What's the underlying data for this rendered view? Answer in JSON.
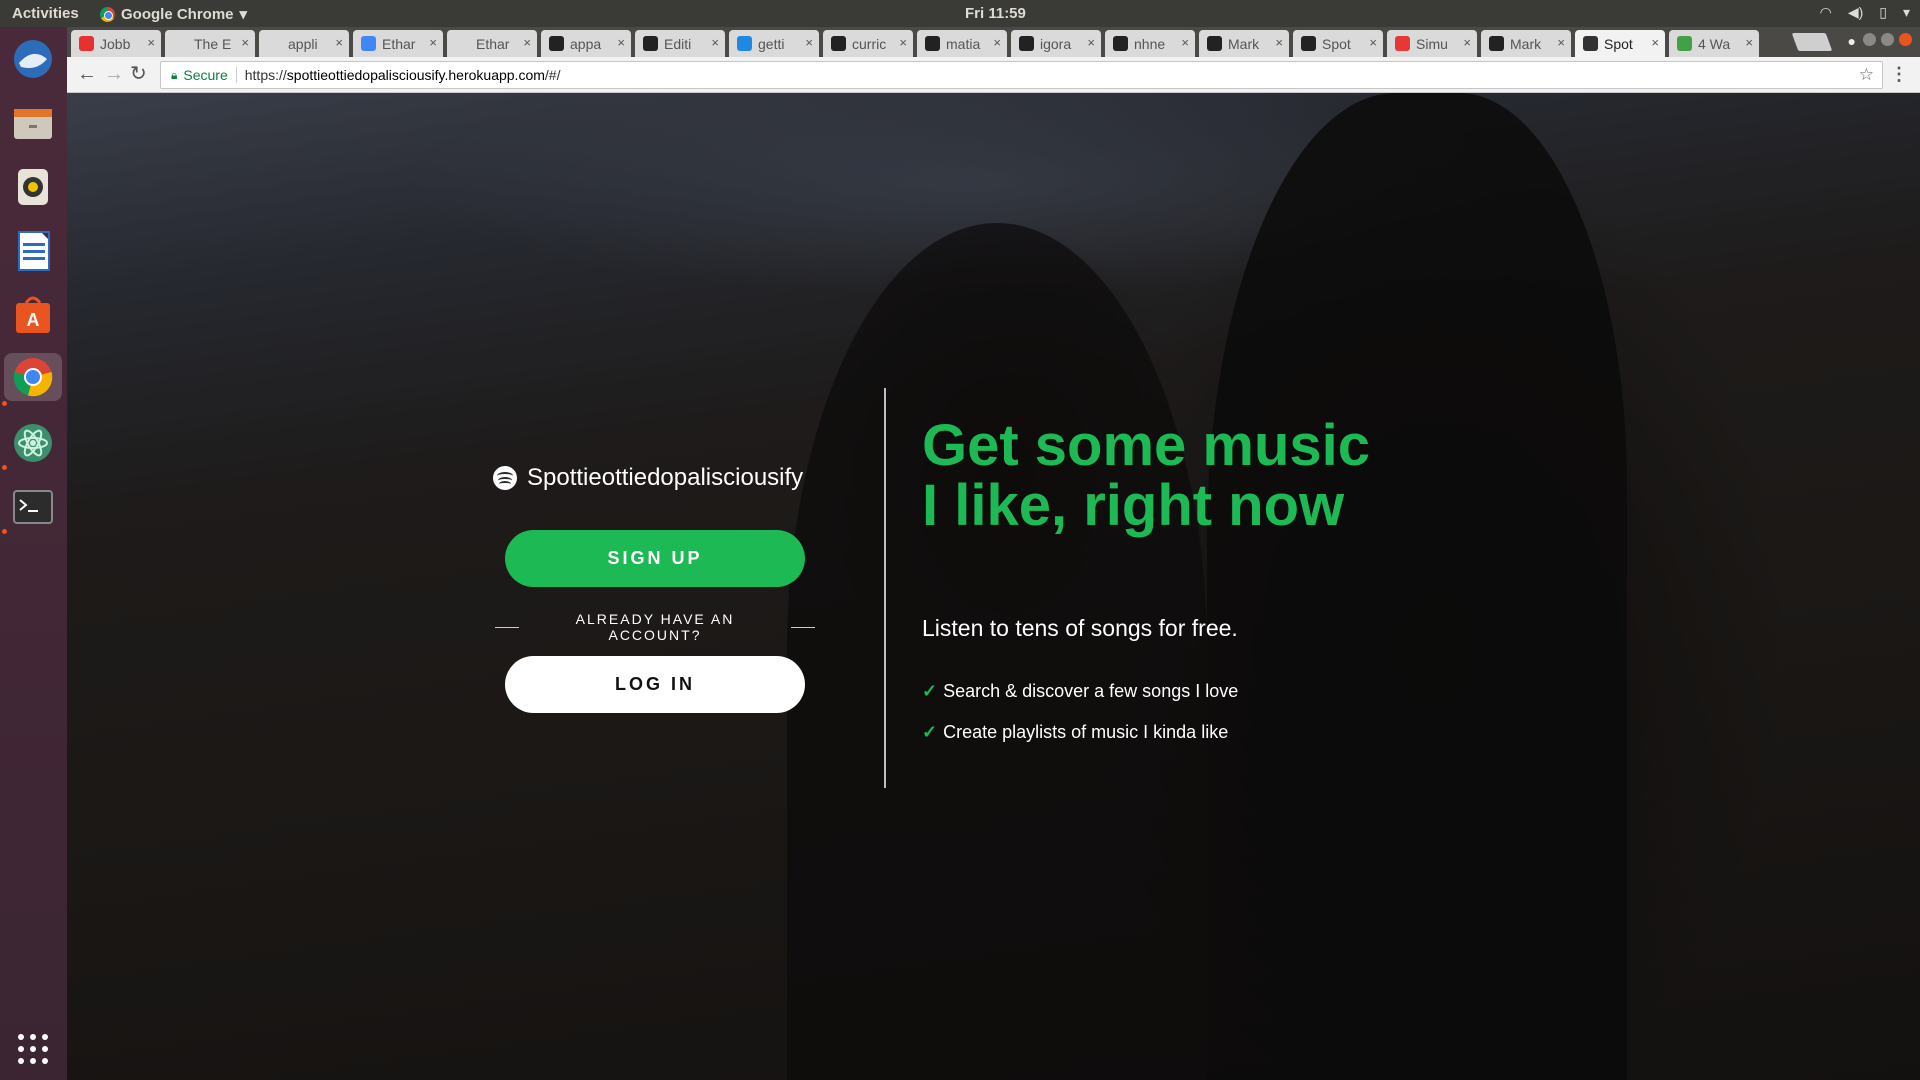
{
  "system_bar": {
    "activities": "Activities",
    "app_name": "Google Chrome",
    "clock": "Fri 11:59"
  },
  "launcher": {
    "apps": [
      "thunderbird-icon",
      "files-icon",
      "rhythmbox-icon",
      "writer-icon",
      "software-center-icon",
      "chrome-icon",
      "atom-icon",
      "terminal-icon",
      "show-apps-icon"
    ]
  },
  "browser": {
    "tabs": [
      {
        "label": "Jobb",
        "favicon_color": "#e8312f"
      },
      {
        "label": "The E",
        "favicon_color": "#dadada"
      },
      {
        "label": "appli",
        "favicon_color": "#dadada"
      },
      {
        "label": "Ethar",
        "favicon_color": "#4285f4"
      },
      {
        "label": "Ethar",
        "favicon_color": "#dadada"
      },
      {
        "label": "appa",
        "favicon_color": "#222222"
      },
      {
        "label": "Editi",
        "favicon_color": "#222222"
      },
      {
        "label": "getti",
        "favicon_color": "#1e88e5"
      },
      {
        "label": "curric",
        "favicon_color": "#222222"
      },
      {
        "label": "matia",
        "favicon_color": "#222222"
      },
      {
        "label": "igora",
        "favicon_color": "#222222"
      },
      {
        "label": "nhne",
        "favicon_color": "#222222"
      },
      {
        "label": "Mark",
        "favicon_color": "#222222"
      },
      {
        "label": "Spot",
        "favicon_color": "#222222"
      },
      {
        "label": "Simu",
        "favicon_color": "#e53935"
      },
      {
        "label": "Mark",
        "favicon_color": "#222222"
      },
      {
        "label": "Spot",
        "favicon_color": "#333333",
        "active": true
      },
      {
        "label": "4 Wa",
        "favicon_color": "#43a047"
      }
    ],
    "tab_close": "×",
    "secure_label": "Secure",
    "url_prefix": "https://",
    "url_domain": "spottieottiedopalisciousify.herokuapp.com",
    "url_path": "/#/"
  },
  "page": {
    "brand_name": "Spottieottiedopalisciousify",
    "signup_label": "SIGN UP",
    "already_label": "ALREADY HAVE AN ACCOUNT?",
    "login_label": "LOG IN",
    "headline": "Get some music I like, right now",
    "subline": "Listen to tens of songs for free.",
    "features": [
      "Search & discover a few songs I love",
      "Create playlists of music I kinda like"
    ],
    "accent_color": "#1db954"
  }
}
